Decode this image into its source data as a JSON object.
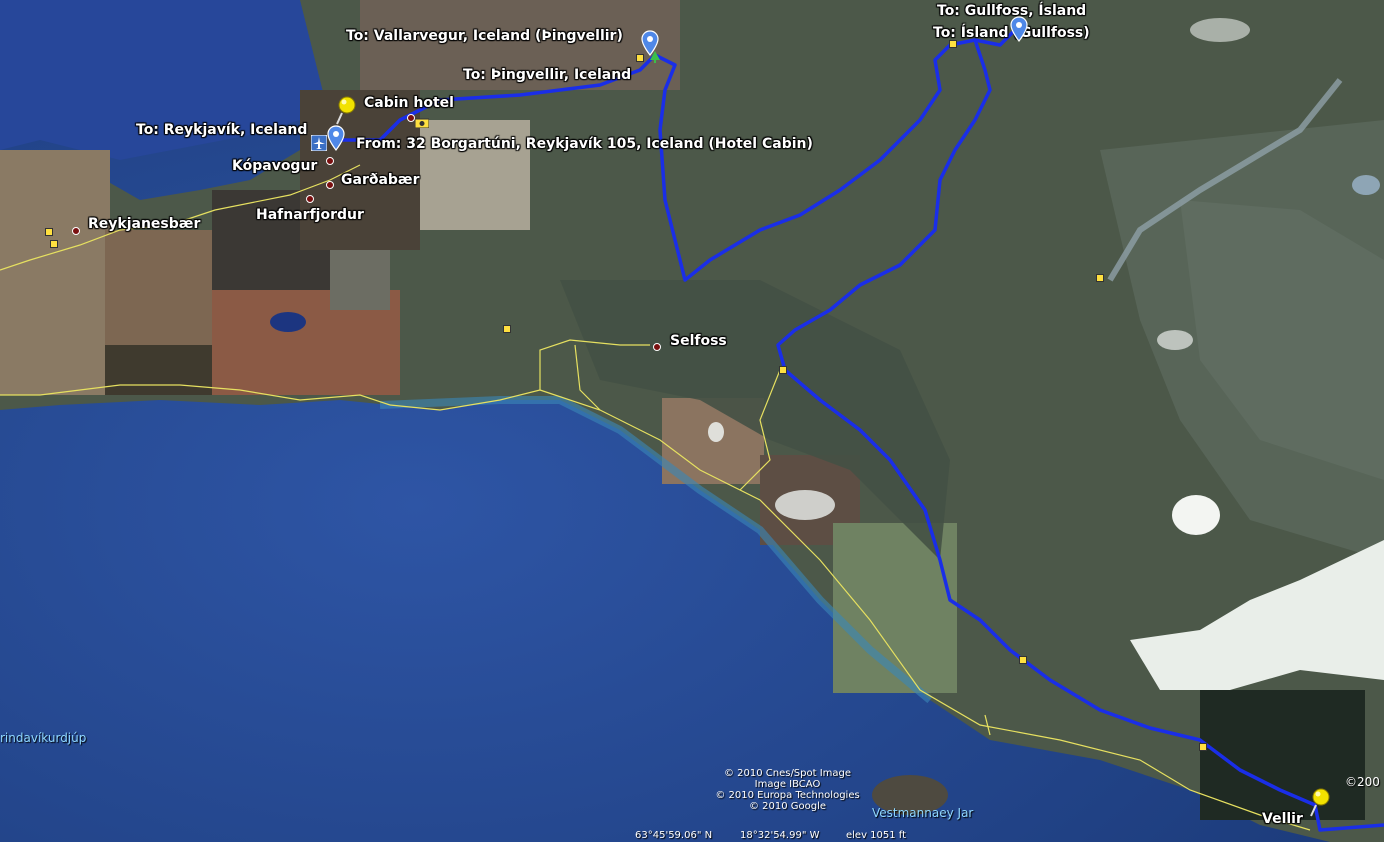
{
  "places": {
    "reykjanesbaer": "Reykjanesbær",
    "kopavogur": "Kópavogur",
    "gardabaer": "Garðabær",
    "hafnarfjordur": "Hafnarfjordur",
    "selfoss": "Selfoss",
    "vellir": "Vellir",
    "vestmannaeyjar": "Vestmannaey Jar",
    "grindavikurdjup": "rindavíkurdjúp"
  },
  "route_labels": {
    "to_vallarvegur": "To: Vallarvegur, Iceland (Þingvellir)",
    "to_thingvellir": "To: Þingvellir, Iceland",
    "cabin_hotel": "Cabin hotel",
    "to_reykjavik": "To: Reykjavík, Iceland",
    "from_hotel": "From: 32 Borgartúni, Reykjavík 105, Iceland (Hotel Cabin)",
    "to_gullfoss_island": "To: Gullfoss, Ísland",
    "to_island_gullfoss": "To: Ísland (Gullfoss)"
  },
  "credits": {
    "line1": "© 2010 Cnes/Spot Image",
    "line2": "Image IBCAO",
    "line3": "© 2010 Europa Technologies",
    "line4": "© 2010 Google",
    "corner": "©200"
  },
  "status_bar": {
    "lat": "63°45'59.06\" N",
    "lon": "18°32'54.99\" W",
    "elev": "elev  1051 ft"
  },
  "icons": [
    "placemark-pin-icon",
    "pushpin-icon",
    "airport-icon",
    "camera-icon",
    "park-icon",
    "road-marker-icon"
  ],
  "colors": {
    "route": "#1a2ee8",
    "road": "#e6e060",
    "ocean": "#2a4f99",
    "land": "#4d5a4c"
  }
}
